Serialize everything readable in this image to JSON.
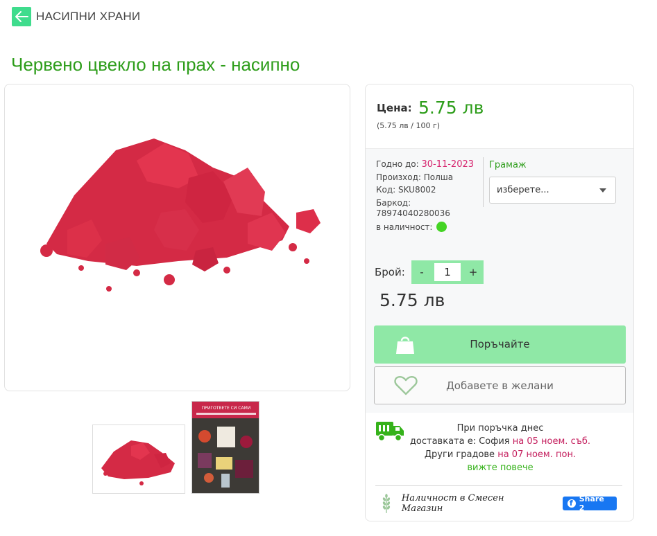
{
  "nav": {
    "back_label": "НАСИПНИ ХРАНИ"
  },
  "product": {
    "title": "Червено цвекло на прах - насипно"
  },
  "price": {
    "label": "Цена:",
    "value": "5.75 лв",
    "unit_price": "(5.75 лв / 100 г)"
  },
  "details": {
    "expiry_label": "Годно до:",
    "expiry_value": "30-11-2023",
    "origin": "Произход: Полша",
    "sku": "Код: SKU8002",
    "barcode_label": "Баркод:",
    "barcode_value": "78974040280036",
    "stock_label": "в наличност:",
    "stock_color": "#44d424"
  },
  "grams": {
    "label": "Грамаж",
    "selected": "изберете..."
  },
  "quantity": {
    "label": "Брой:",
    "minus": "-",
    "value": "1",
    "plus": "+",
    "total": "5.75 лв"
  },
  "buttons": {
    "order": "Поръчайте",
    "wishlist": "Добавете в желани"
  },
  "delivery": {
    "line1": "При поръчка днес",
    "line2_prefix": "доставката е: София",
    "line2_date": "на 05 ноем. съб.",
    "line3_prefix": "Други градове",
    "line3_date": "на 07 ноем. пон.",
    "more": "вижте повече"
  },
  "store": {
    "label": "Наличност в Смесен Магазин",
    "share": "Share 2"
  },
  "thumb2": {
    "title": "ПРИГОТВЕТЕ СИ САМИ"
  },
  "colors": {
    "accent_green": "#2d9d1a",
    "button_green": "#8fe8a6",
    "date_pink": "#d6246e"
  }
}
